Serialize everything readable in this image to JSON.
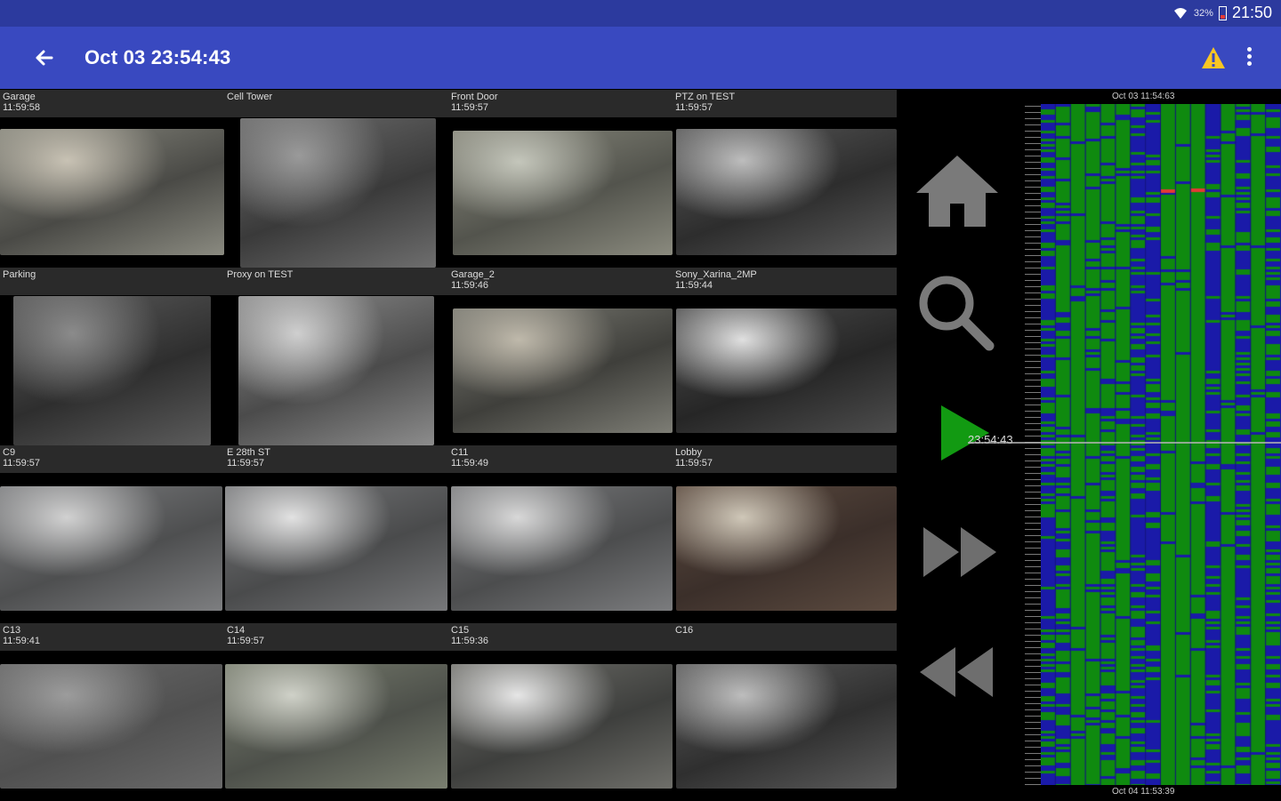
{
  "status_bar": {
    "battery_percent": "32%",
    "time": "21:50",
    "icons": [
      "wifi-icon",
      "battery-icon"
    ]
  },
  "app_bar": {
    "title": "Oct 03 23:54:43",
    "back_icon": "arrow-left-icon",
    "warning_icon": "warning-icon",
    "menu_icon": "more-vert-icon"
  },
  "cameras": [
    {
      "name": "Garage",
      "time": "11:59:58"
    },
    {
      "name": "Cell Tower",
      "time": ""
    },
    {
      "name": "Front Door",
      "time": "11:59:57"
    },
    {
      "name": "PTZ on TEST",
      "time": "11:59:57"
    },
    {
      "name": "Parking",
      "time": ""
    },
    {
      "name": "Proxy on TEST",
      "time": ""
    },
    {
      "name": "Garage_2",
      "time": "11:59:46"
    },
    {
      "name": "Sony_Xarina_2MP",
      "time": "11:59:44"
    },
    {
      "name": "C9",
      "time": "11:59:57"
    },
    {
      "name": "E 28th ST",
      "time": "11:59:57"
    },
    {
      "name": "C11",
      "time": "11:59:49"
    },
    {
      "name": "Lobby",
      "time": "11:59:57"
    },
    {
      "name": "C13",
      "time": "11:59:41"
    },
    {
      "name": "C14",
      "time": "11:59:57"
    },
    {
      "name": "C15",
      "time": "11:59:36"
    },
    {
      "name": "C16",
      "time": ""
    }
  ],
  "controls": {
    "home_icon": "home-icon",
    "search_icon": "search-icon",
    "play_icon": "play-icon",
    "fast_forward_icon": "fast-forward-icon",
    "rewind_icon": "rewind-icon",
    "play_time": "23:54:43"
  },
  "timeline": {
    "start_label": "Oct 03 11:54:63",
    "end_label": "Oct 04 11:53:39",
    "colors": {
      "none": "#1a1aa8",
      "motion": "#0f8a0f",
      "alert": "#e53935"
    }
  },
  "colors": {
    "statusbar": "#2c3a9e",
    "appbar": "#3949c0",
    "play": "#129a12"
  }
}
